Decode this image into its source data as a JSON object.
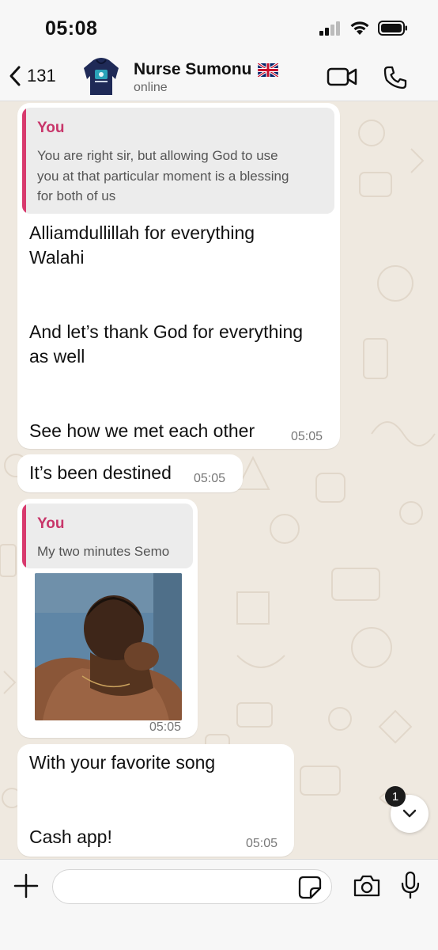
{
  "status_bar": {
    "time": "05:08"
  },
  "header": {
    "back_count": "131",
    "contact_name": "Nurse Sumonu",
    "flag": "🇬🇧",
    "status": "online"
  },
  "messages": [
    {
      "quote_author": "You",
      "quote_lines": [
        "You are right sir, but allowing God to use",
        "you at that particular moment is a blessing",
        "for both of us"
      ],
      "lines": [
        "Alliamdullillah for everything",
        "Walahi",
        "",
        "",
        "And let’s thank God for everything",
        "as well",
        "",
        "",
        "See how we met each other"
      ],
      "time": "05:05"
    },
    {
      "text": "It’s been destined",
      "time": "05:05"
    },
    {
      "quote_author": "You",
      "quote_text": "My two minutes Semo",
      "image_icon": "photo-of-man-crying",
      "time": "05:05"
    },
    {
      "lines": [
        "With your favorite song",
        "",
        "Cash app!"
      ],
      "time": "05:05"
    }
  ],
  "scroll": {
    "unread_count": "1"
  },
  "input": {
    "placeholder": ""
  },
  "colors": {
    "accent": "#d83a6e",
    "bubble": "#ffffff",
    "wallpaper": "#efe9e0"
  }
}
